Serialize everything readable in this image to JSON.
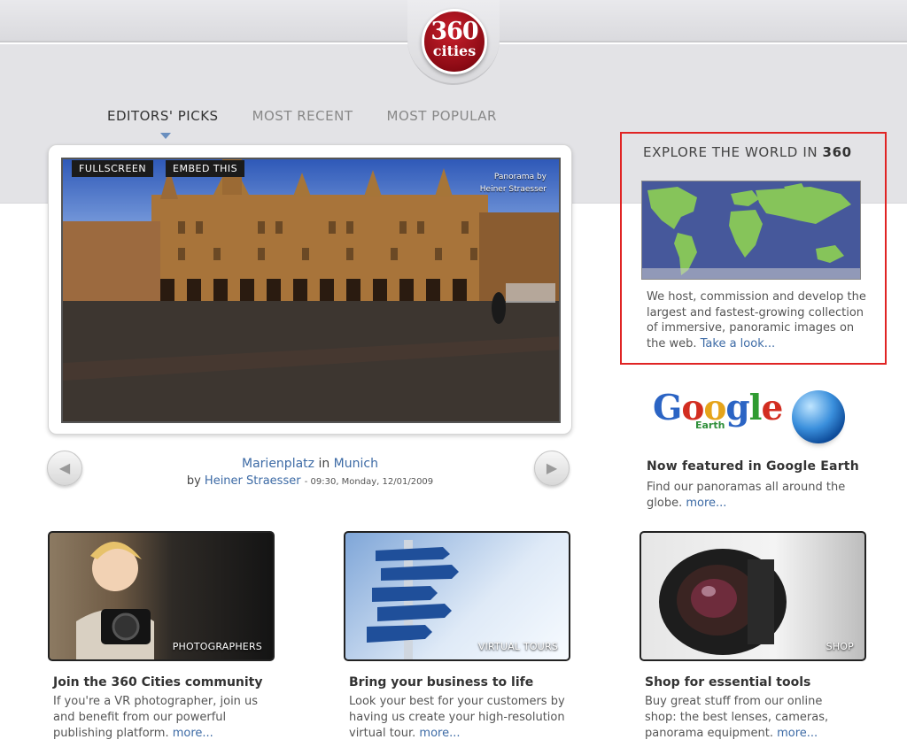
{
  "logo": {
    "number": "360",
    "word": "cities"
  },
  "tabs": [
    {
      "label": "EDITORS' PICKS",
      "active": true
    },
    {
      "label": "MOST RECENT",
      "active": false
    },
    {
      "label": "MOST POPULAR",
      "active": false
    }
  ],
  "panorama": {
    "fullscreen_label": "FULLSCREEN",
    "embed_label": "EMBED THIS",
    "credit_line1": "Panorama by",
    "credit_line2": "Heiner Straesser",
    "place": "Marienplatz",
    "in_word": "in",
    "city": "Munich",
    "by_word": "by",
    "author": "Heiner Straesser",
    "datetime": "- 09:30, Monday, 12/01/2009",
    "prev_icon": "left-arrow-icon",
    "next_icon": "right-arrow-icon"
  },
  "explore": {
    "title_prefix": "EXPLORE THE WORLD IN",
    "title_bold": "360",
    "text": "We host, commission and develop the largest and fastest-growing collection of immersive, panoramic images on the web.",
    "link": "Take a look..."
  },
  "google_earth": {
    "logo_text": "Google",
    "earth_label": "Earth",
    "title": "Now featured in Google Earth",
    "text": "Find our panoramas all around the globe.",
    "link": "more..."
  },
  "cards": [
    {
      "label": "PHOTOGRAPHERS",
      "title": "Join the 360 Cities community",
      "text": "If you're a VR photographer, join us and benefit from our powerful publishing platform.",
      "link": "more..."
    },
    {
      "label": "VIRTUAL TOURS",
      "title": "Bring your business to life",
      "text": "Look your best for your customers by having us create your high-resolution virtual tour.",
      "link": "more..."
    },
    {
      "label": "SHOP",
      "title": "Shop for essential tools",
      "text": "Buy great stuff from our online shop: the best lenses, cameras, panorama equipment.",
      "link": "more..."
    }
  ],
  "colors": {
    "brand_red": "#b0141f",
    "link_blue": "#3c6aa5",
    "highlight_border": "#e02424"
  }
}
